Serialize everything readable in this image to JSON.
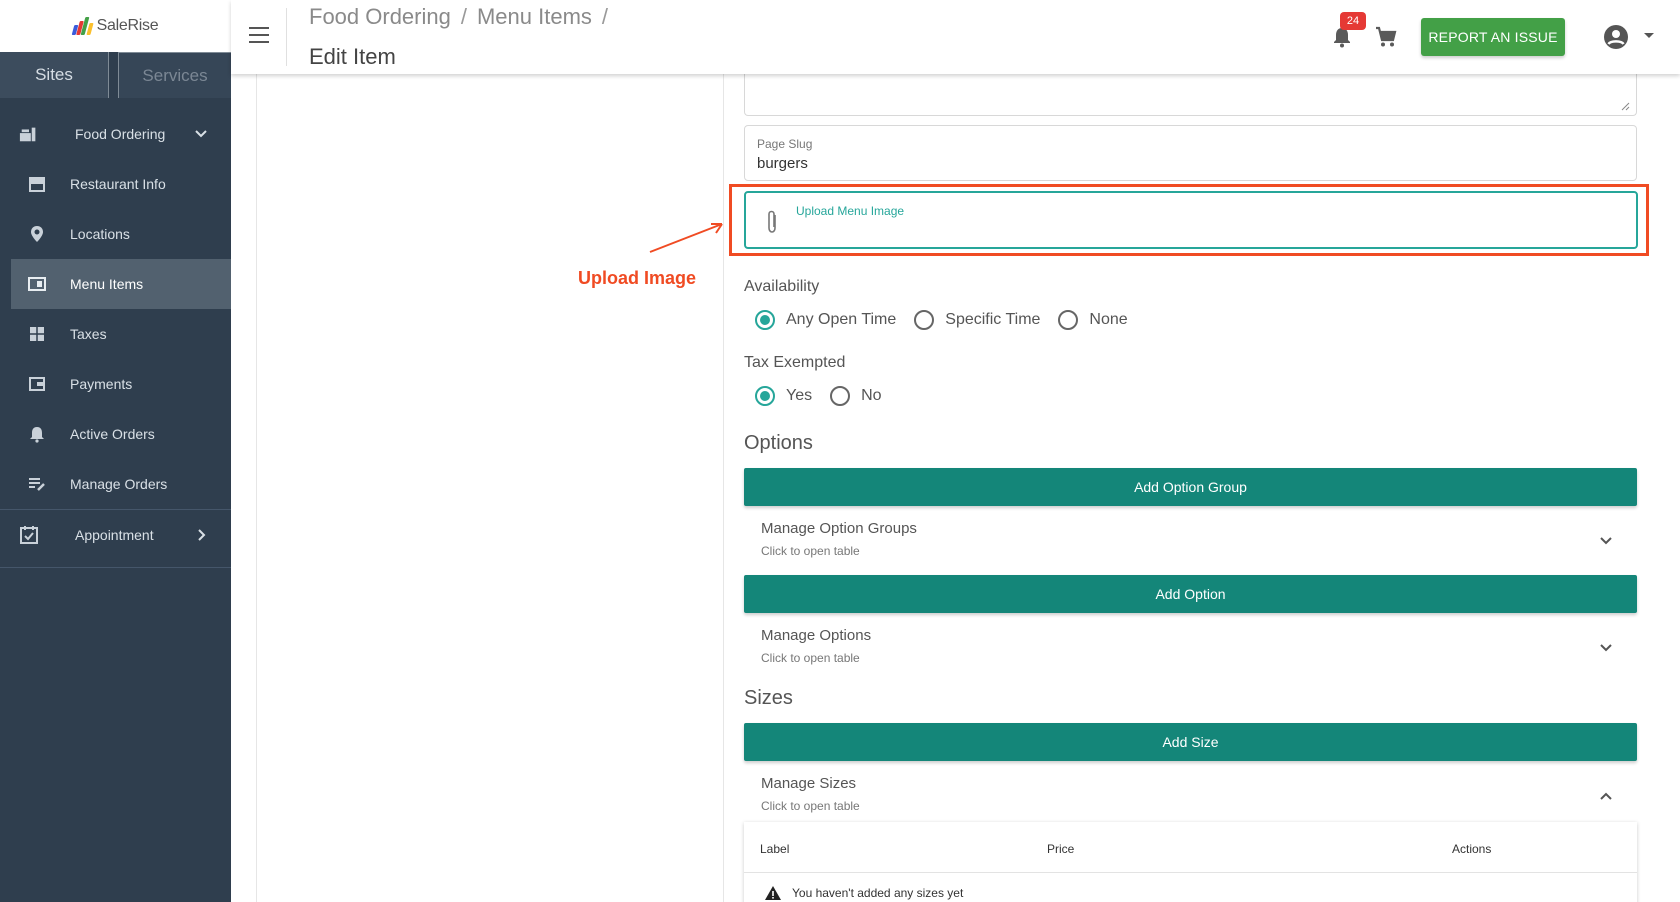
{
  "brand": {
    "name": "SaleRise"
  },
  "sidebar": {
    "tabs": [
      {
        "label": "Sites"
      },
      {
        "label": "Services"
      }
    ],
    "items": [
      {
        "label": "Food Ordering",
        "icon": "food-ordering-icon"
      },
      {
        "label": "Restaurant Info",
        "icon": "storefront-icon"
      },
      {
        "label": "Locations",
        "icon": "location-pin-icon"
      },
      {
        "label": "Menu Items",
        "icon": "menu-book-icon"
      },
      {
        "label": "Taxes",
        "icon": "calculator-icon"
      },
      {
        "label": "Payments",
        "icon": "wallet-icon"
      },
      {
        "label": "Active Orders",
        "icon": "bell-icon"
      },
      {
        "label": "Manage Orders",
        "icon": "list-edit-icon"
      },
      {
        "label": "Appointment",
        "icon": "calendar-check-icon"
      }
    ]
  },
  "header": {
    "breadcrumbs": [
      "Food Ordering",
      "Menu Items"
    ],
    "breadcrumb_sep": "/",
    "title": "Edit Item",
    "notification_count": "24",
    "report_label": "REPORT AN ISSUE"
  },
  "form": {
    "slug_label": "Page Slug",
    "slug_value": "burgers",
    "upload_label": "Upload Menu Image",
    "annotation": "Upload Image",
    "availability": {
      "label": "Availability",
      "options": [
        "Any Open Time",
        "Specific Time",
        "None"
      ],
      "selected": "Any Open Time"
    },
    "tax_exempted": {
      "label": "Tax Exempted",
      "options": [
        "Yes",
        "No"
      ],
      "selected": "Yes"
    }
  },
  "options_section": {
    "heading": "Options",
    "add_group_label": "Add Option Group",
    "manage_groups_title": "Manage Option Groups",
    "manage_groups_sub": "Click to open table",
    "add_option_label": "Add Option",
    "manage_options_title": "Manage Options",
    "manage_options_sub": "Click to open table"
  },
  "sizes_section": {
    "heading": "Sizes",
    "add_size_label": "Add Size",
    "manage_title": "Manage Sizes",
    "manage_sub": "Click to open table",
    "columns": [
      "Label",
      "Price",
      "Actions"
    ],
    "empty_text": "You haven't added any sizes yet"
  },
  "colors": {
    "sidebar_bg": "#2f3e4e",
    "accent_teal": "#148679",
    "report_green": "#43a047",
    "annotation_red": "#f04b23"
  }
}
